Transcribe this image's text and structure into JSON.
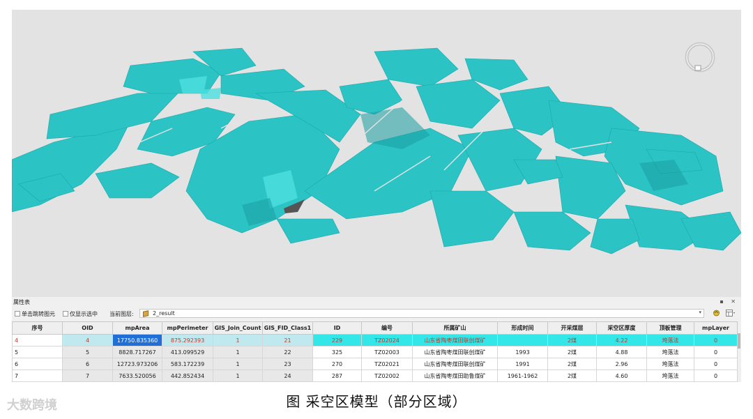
{
  "viewport": {
    "background": "#e3e3e3",
    "model_color": "#29c2c4",
    "nav_control": "navigation-ring-icon"
  },
  "panel": {
    "title": "属性表",
    "window_buttons": "▪ ✕"
  },
  "toolbar": {
    "option1": "单击跳转图元",
    "option2": "仅显示选中",
    "layer_label": "当前图层:",
    "layer_value": "2_result"
  },
  "table": {
    "columns": [
      "序号",
      "OID",
      "mpArea",
      "mpPerimeter",
      "GIS_Join_Count",
      "GIS_FID_Class1",
      "ID",
      "编号",
      "所属矿山",
      "形成时间",
      "开采煤层",
      "采空区厚度",
      "顶板管理",
      "mpLayer"
    ],
    "rows": [
      [
        "4",
        "4",
        "17750.835360",
        "875.292393",
        "1",
        "21",
        "229",
        "TZ02024",
        "山东省陶枣煤田联创煤矿",
        "",
        "2煤",
        "4.22",
        "垮落法",
        "0"
      ],
      [
        "5",
        "5",
        "8828.717267",
        "413.099529",
        "1",
        "22",
        "325",
        "TZ02003",
        "山东省陶枣煤田联创煤矿",
        "1993",
        "2煤",
        "4.88",
        "垮落法",
        "0"
      ],
      [
        "6",
        "6",
        "12723.973206",
        "583.172239",
        "1",
        "23",
        "270",
        "TZ02021",
        "山东省陶枣煤田联创煤矿",
        "1991",
        "2煤",
        "2.96",
        "垮落法",
        "0"
      ],
      [
        "7",
        "7",
        "7633.520056",
        "442.852434",
        "1",
        "24",
        "287",
        "TZ02002",
        "山东省陶枣煤田助鲁煤矿",
        "1961-1962",
        "2煤",
        "4.60",
        "垮落法",
        "0"
      ]
    ]
  },
  "caption": "图  采空区模型（部分区域）",
  "watermark": "大数跨境"
}
